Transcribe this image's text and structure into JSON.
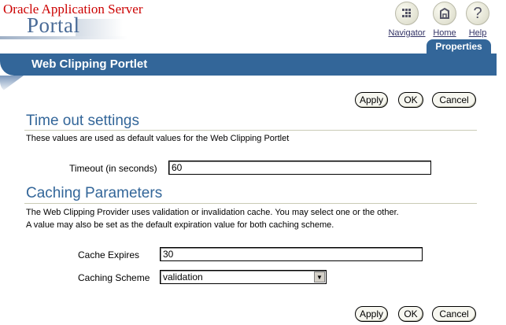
{
  "header": {
    "brand_line1": "Oracle Application Server",
    "brand_line2": "Portal"
  },
  "nav": [
    {
      "label": "Navigator",
      "icon": "navigator-icon"
    },
    {
      "label": "Home",
      "icon": "home-icon"
    },
    {
      "label": "Help",
      "icon": "help-icon",
      "glyph": "?"
    }
  ],
  "tab": {
    "label": "Properties"
  },
  "page_title": "Web Clipping Portlet",
  "buttons": {
    "apply": "Apply",
    "ok": "OK",
    "cancel": "Cancel"
  },
  "timeout_section": {
    "heading": "Time out settings",
    "description": "These values are used as default values for the Web Clipping Portlet",
    "timeout_label": "Timeout (in seconds)",
    "timeout_value": "60"
  },
  "caching_section": {
    "heading": "Caching Parameters",
    "description_line1": "The Web Clipping Provider uses validation or invalidation cache. You may select one or the other.",
    "description_line2": "A value may also be set as the default expiration value for both caching scheme.",
    "expires_label": "Cache Expires",
    "expires_value": "30",
    "scheme_label": "Caching Scheme",
    "scheme_value": "validation"
  },
  "colors": {
    "accent": "#336699",
    "brand_red": "#cc0000",
    "page_bg": "#ffffff"
  }
}
